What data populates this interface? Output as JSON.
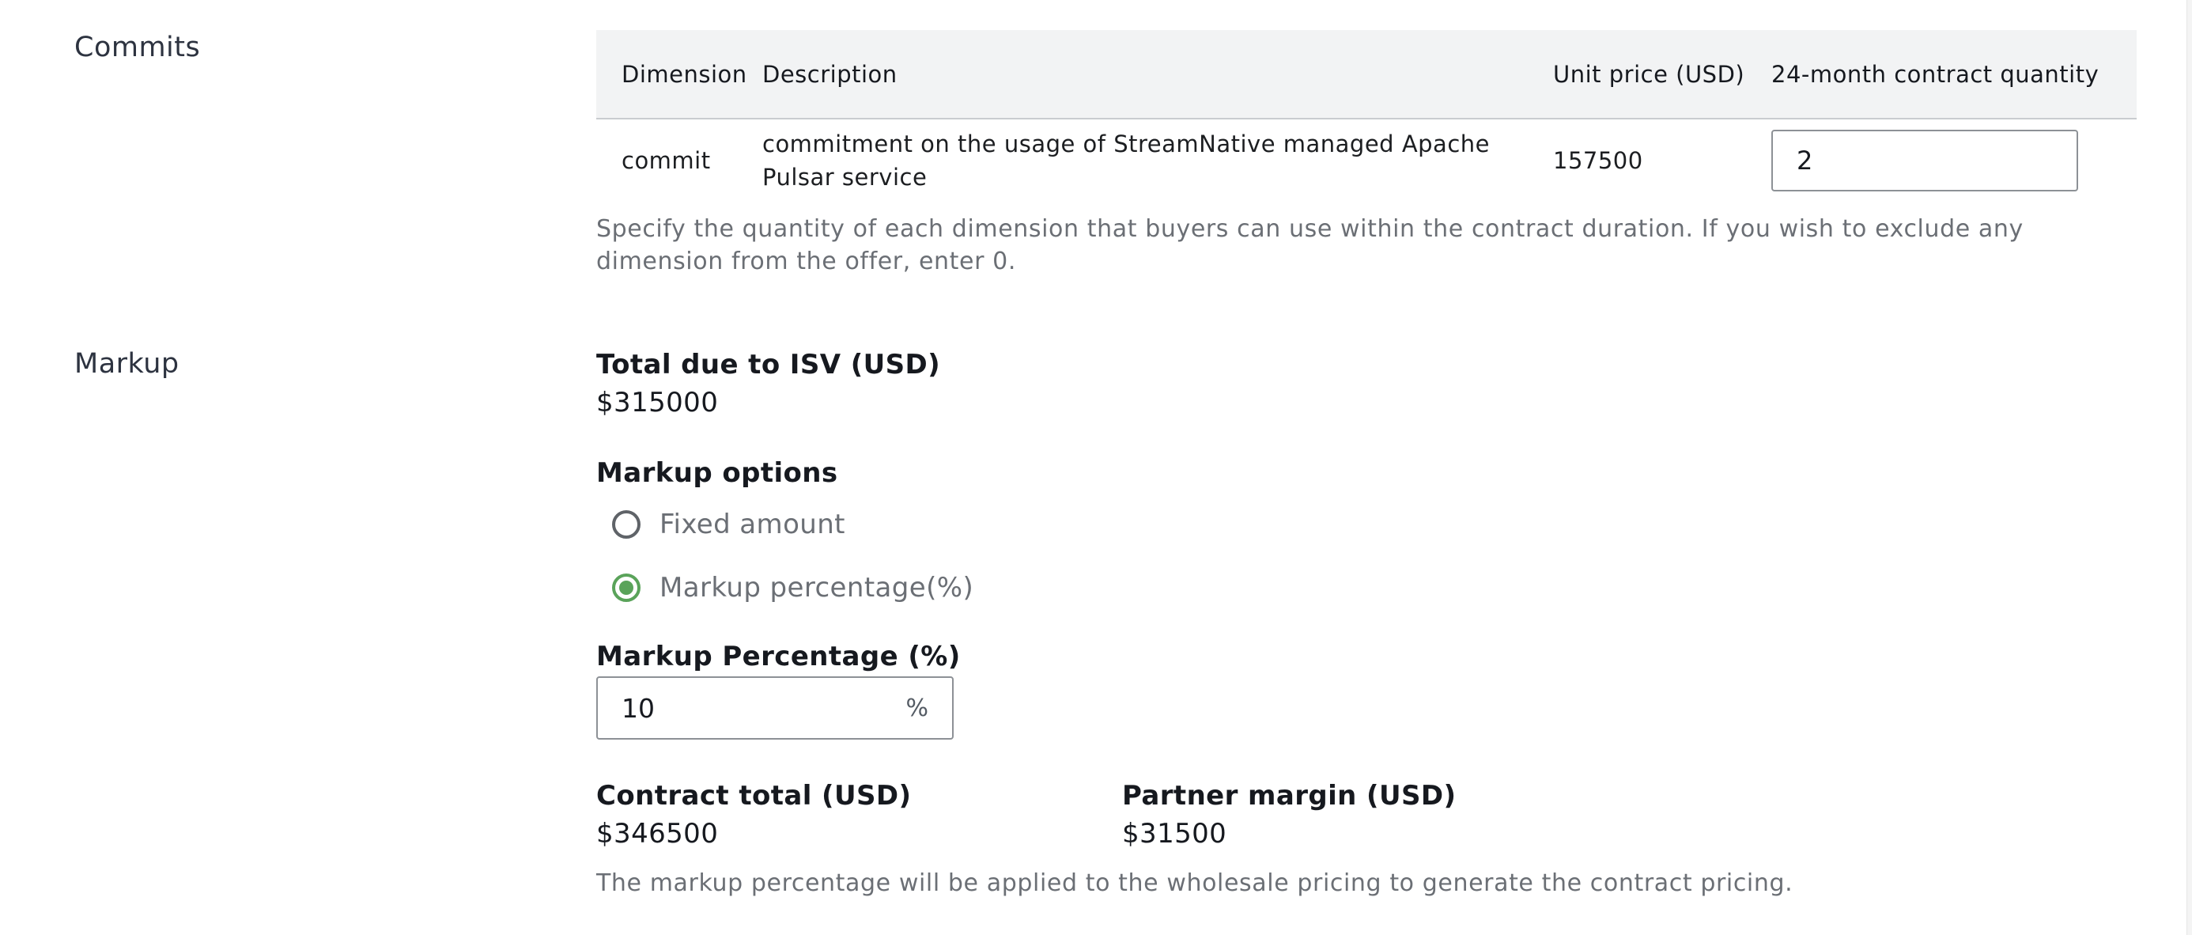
{
  "sections": {
    "commits_label": "Commits",
    "markup_label": "Markup"
  },
  "commits_table": {
    "headers": {
      "dimension": "Dimension",
      "description": "Description",
      "unit_price": "Unit price (USD)",
      "quantity": "24-month contract quantity"
    },
    "rows": [
      {
        "dimension": "commit",
        "description": "commitment on the usage of StreamNative managed Apache Pulsar service",
        "unit_price": "157500",
        "quantity": "2"
      }
    ],
    "help_text": "Specify the quantity of each dimension that buyers can use within the contract duration. If you wish to exclude any dimension from the offer, enter 0."
  },
  "markup": {
    "total_due_label": "Total due to ISV (USD)",
    "total_due_value": "$315000",
    "options_label": "Markup options",
    "options": [
      {
        "label": "Fixed amount",
        "selected": false
      },
      {
        "label": "Markup percentage(%)",
        "selected": true
      }
    ],
    "percentage_label": "Markup Percentage (%)",
    "percentage_value": "10",
    "percentage_suffix": "%",
    "contract_total_label": "Contract total (USD)",
    "contract_total_value": "$346500",
    "partner_margin_label": "Partner margin (USD)",
    "partner_margin_value": "$31500",
    "help_text": "The markup percentage will be applied to the wholesale pricing to generate the contract pricing."
  },
  "colors": {
    "radio_selected": "#5aa35a",
    "header_bg": "#f2f3f4",
    "help_text": "#6b6f75"
  }
}
